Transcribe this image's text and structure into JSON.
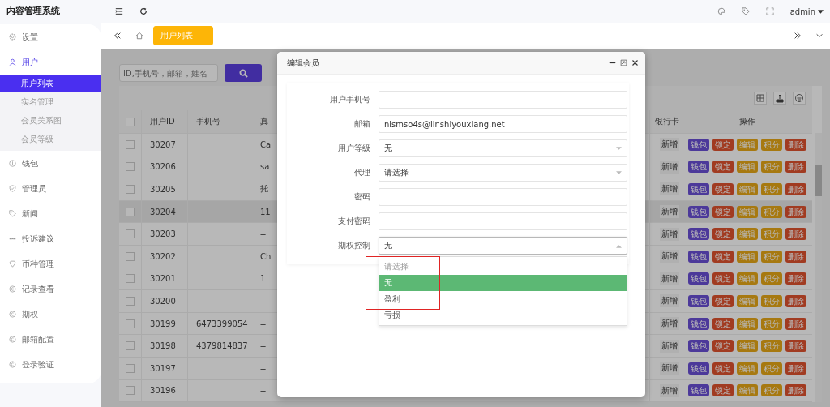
{
  "app_title": "内容管理系统",
  "header": {
    "user": "admin"
  },
  "tabs": [
    {
      "label": "用户列表",
      "selected": true
    }
  ],
  "sidebar": {
    "items": [
      {
        "label": "设置",
        "selected": false
      },
      {
        "label": "用户",
        "selected": true,
        "expanded": true,
        "children": [
          {
            "label": "用户列表",
            "selected": true
          },
          {
            "label": "实名管理",
            "selected": false
          },
          {
            "label": "会员关系图",
            "selected": false
          },
          {
            "label": "会员等级",
            "selected": false
          }
        ]
      },
      {
        "label": "钱包",
        "selected": false
      },
      {
        "label": "管理员",
        "selected": false
      },
      {
        "label": "新闻",
        "selected": false
      },
      {
        "label": "投诉建议",
        "selected": false
      },
      {
        "label": "币种管理",
        "selected": false
      },
      {
        "label": "记录查看",
        "selected": false
      },
      {
        "label": "期权",
        "selected": false
      },
      {
        "label": "邮箱配置",
        "selected": false
      },
      {
        "label": "登录验证",
        "selected": false
      }
    ]
  },
  "search": {
    "placeholder": "ID,手机号，邮箱，姓名"
  },
  "table": {
    "header_checked": false,
    "columns": [
      "用户ID",
      "手机号",
      "真",
      "银行卡",
      "操作"
    ],
    "rows": [
      {
        "id": "30207",
        "column_3": "Ca",
        "bank": "新增",
        "hovered": false,
        "checked": false,
        "actions": [
          {
            "label": "钱包",
            "kind": "wallet"
          },
          {
            "label": "锁定",
            "kind": "lock"
          },
          {
            "label": "编辑",
            "kind": "edit"
          },
          {
            "label": "积分",
            "kind": "points"
          },
          {
            "label": "删除",
            "kind": "delete"
          }
        ]
      },
      {
        "id": "30206",
        "column_3": "sa",
        "bank": "新增",
        "hovered": false,
        "checked": false,
        "actions": [
          {
            "label": "钱包",
            "kind": "wallet"
          },
          {
            "label": "锁定",
            "kind": "lock"
          },
          {
            "label": "编辑",
            "kind": "edit"
          },
          {
            "label": "积分",
            "kind": "points"
          },
          {
            "label": "删除",
            "kind": "delete"
          }
        ]
      },
      {
        "id": "30205",
        "column_3": "托",
        "bank": "新增",
        "hovered": false,
        "checked": false,
        "actions": [
          {
            "label": "钱包",
            "kind": "wallet"
          },
          {
            "label": "锁定",
            "kind": "lock"
          },
          {
            "label": "编辑",
            "kind": "edit"
          },
          {
            "label": "积分",
            "kind": "points"
          },
          {
            "label": "删除",
            "kind": "delete"
          }
        ]
      },
      {
        "id": "30204",
        "column_3": "11",
        "bank": "新增",
        "hovered": true,
        "checked": false,
        "actions": [
          {
            "label": "钱包",
            "kind": "wallet"
          },
          {
            "label": "锁定",
            "kind": "lock"
          },
          {
            "label": "编辑",
            "kind": "edit"
          },
          {
            "label": "积分",
            "kind": "points"
          },
          {
            "label": "删除",
            "kind": "delete"
          }
        ]
      },
      {
        "id": "30203",
        "column_3": "--",
        "bank": "新增",
        "hovered": false,
        "checked": false,
        "actions": [
          {
            "label": "钱包",
            "kind": "wallet"
          },
          {
            "label": "锁定",
            "kind": "lock"
          },
          {
            "label": "编辑",
            "kind": "edit"
          },
          {
            "label": "积分",
            "kind": "points"
          },
          {
            "label": "删除",
            "kind": "delete"
          }
        ]
      },
      {
        "id": "30202",
        "column_3": "Ch",
        "bank": "新增",
        "hovered": false,
        "checked": false,
        "actions": [
          {
            "label": "钱包",
            "kind": "wallet"
          },
          {
            "label": "锁定",
            "kind": "lock"
          },
          {
            "label": "编辑",
            "kind": "edit"
          },
          {
            "label": "积分",
            "kind": "points"
          },
          {
            "label": "删除",
            "kind": "delete"
          }
        ]
      },
      {
        "id": "30201",
        "column_3": "1",
        "bank": "新增",
        "hovered": false,
        "checked": false,
        "actions": [
          {
            "label": "钱包",
            "kind": "wallet"
          },
          {
            "label": "锁定",
            "kind": "lock"
          },
          {
            "label": "编辑",
            "kind": "edit"
          },
          {
            "label": "积分",
            "kind": "points"
          },
          {
            "label": "删除",
            "kind": "delete"
          }
        ]
      },
      {
        "id": "30200",
        "column_3": "--",
        "bank": "新增",
        "hovered": false,
        "checked": false,
        "actions": [
          {
            "label": "钱包",
            "kind": "wallet"
          },
          {
            "label": "锁定",
            "kind": "lock"
          },
          {
            "label": "编辑",
            "kind": "edit"
          },
          {
            "label": "积分",
            "kind": "points"
          },
          {
            "label": "删除",
            "kind": "delete"
          }
        ]
      },
      {
        "id": "30199",
        "phone": "6473399054",
        "column_3": "--",
        "bank": "新增",
        "hovered": false,
        "checked": false,
        "actions": [
          {
            "label": "钱包",
            "kind": "wallet"
          },
          {
            "label": "锁定",
            "kind": "lock"
          },
          {
            "label": "编辑",
            "kind": "edit"
          },
          {
            "label": "积分",
            "kind": "points"
          },
          {
            "label": "删除",
            "kind": "delete"
          }
        ]
      },
      {
        "id": "30198",
        "phone": "4379814837",
        "column_3": "--",
        "bank": "新增",
        "hovered": false,
        "checked": false,
        "actions": [
          {
            "label": "钱包",
            "kind": "wallet"
          },
          {
            "label": "锁定",
            "kind": "lock"
          },
          {
            "label": "编辑",
            "kind": "edit"
          },
          {
            "label": "积分",
            "kind": "points"
          },
          {
            "label": "删除",
            "kind": "delete"
          }
        ]
      },
      {
        "id": "30197",
        "column_3": "--",
        "bank": "新增",
        "hovered": false,
        "checked": false,
        "actions": [
          {
            "label": "钱包",
            "kind": "wallet"
          },
          {
            "label": "锁定",
            "kind": "lock"
          },
          {
            "label": "编辑",
            "kind": "edit"
          },
          {
            "label": "积分",
            "kind": "points"
          },
          {
            "label": "删除",
            "kind": "delete"
          }
        ]
      },
      {
        "id": "30196",
        "column_3": "--",
        "bank": "新增",
        "hovered": false,
        "checked": false,
        "actions": [
          {
            "label": "钱包",
            "kind": "wallet"
          },
          {
            "label": "锁定",
            "kind": "lock"
          },
          {
            "label": "编辑",
            "kind": "edit"
          },
          {
            "label": "积分",
            "kind": "points"
          },
          {
            "label": "删除",
            "kind": "delete"
          }
        ]
      }
    ]
  },
  "modal": {
    "title": "编辑会员",
    "fields": [
      {
        "label": "用户手机号",
        "kind": "input"
      },
      {
        "label": "邮箱",
        "kind": "input",
        "value": "nismso4s@linshiyouxiang.net"
      },
      {
        "label": "用户等级",
        "kind": "select",
        "value": "无",
        "expanded": false
      },
      {
        "label": "代理",
        "kind": "select",
        "value": "请选择",
        "expanded": false
      },
      {
        "label": "密码",
        "kind": "input"
      },
      {
        "label": "支付密码",
        "kind": "input"
      },
      {
        "label": "期权控制",
        "kind": "select",
        "value": "无",
        "expanded": true,
        "options": [
          {
            "label": "请选择",
            "kind": "placeholder",
            "selected": false
          },
          {
            "label": "无",
            "kind": "option",
            "selected": true
          },
          {
            "label": "盈利",
            "kind": "option",
            "selected": false
          },
          {
            "label": "亏损",
            "kind": "option",
            "selected": false
          }
        ]
      }
    ]
  }
}
